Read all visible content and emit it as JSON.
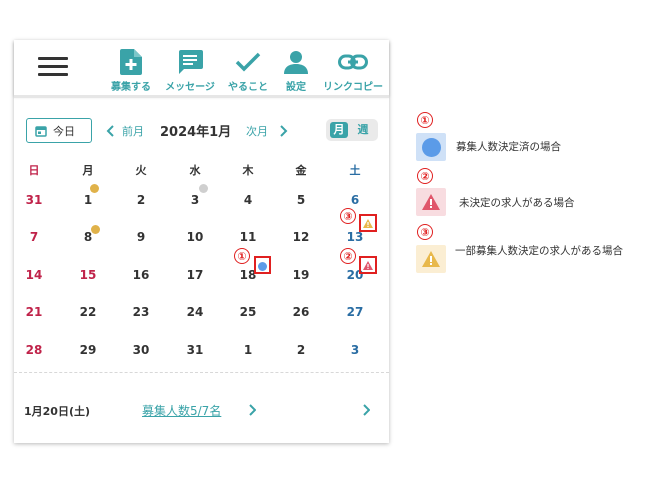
{
  "toolbar": {
    "items": [
      {
        "label": "募集する",
        "icon": "add-document-icon"
      },
      {
        "label": "メッセージ",
        "icon": "message-icon"
      },
      {
        "label": "やること",
        "icon": "check-icon"
      },
      {
        "label": "設定",
        "icon": "person-icon"
      },
      {
        "label": "リンクコピー",
        "icon": "link-icon"
      }
    ]
  },
  "nav": {
    "today_label": "今日",
    "prev_label": "前月",
    "month_title": "2024年1月",
    "next_label": "次月",
    "view_month": "月",
    "view_week": "週"
  },
  "calendar": {
    "weekdays": [
      "日",
      "月",
      "火",
      "水",
      "木",
      "金",
      "土"
    ],
    "weeks": [
      [
        "31",
        "1",
        "2",
        "3",
        "4",
        "5",
        "6"
      ],
      [
        "7",
        "8",
        "9",
        "10",
        "11",
        "12",
        "13"
      ],
      [
        "14",
        "15",
        "16",
        "17",
        "18",
        "19",
        "20"
      ],
      [
        "21",
        "22",
        "23",
        "24",
        "25",
        "26",
        "27"
      ],
      [
        "28",
        "29",
        "30",
        "31",
        "1",
        "2",
        "3"
      ]
    ]
  },
  "footer": {
    "selected_date": "1月20日(土)",
    "recruit_link": "募集人数5/7名"
  },
  "annotations": [
    "①",
    "②",
    "③"
  ],
  "legend": [
    {
      "num": "①",
      "text": "募集人数決定済の場合"
    },
    {
      "num": "②",
      "text": "未決定の求人がある場合"
    },
    {
      "num": "③",
      "text": "一部募集人数決定の求人がある場合"
    }
  ],
  "colors": {
    "accent": "#3aa3a8",
    "sunday": "#c0234a",
    "saturday": "#2a6da3",
    "dot_yellow": "#e0b24a",
    "dot_gray": "#cfcfcf",
    "dot_blue": "#5b9be8",
    "warn_red": "#e0566b",
    "warn_orange": "#e8b84a"
  }
}
